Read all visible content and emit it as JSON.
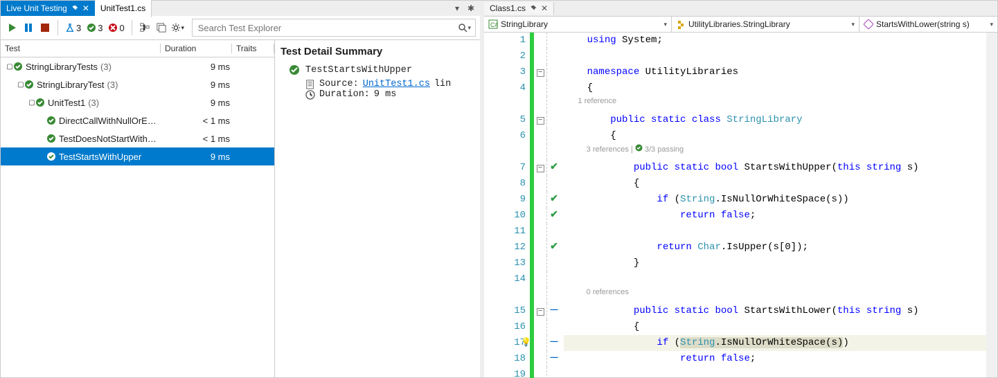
{
  "left": {
    "tabs": {
      "active": "Live Unit Testing",
      "inactive": "UnitTest1.cs"
    },
    "toolbar": {
      "flask_count": "3",
      "pass_count": "3",
      "fail_count": "0",
      "search_placeholder": "Search Test Explorer"
    },
    "columns": {
      "c1": "Test",
      "c2": "Duration",
      "c3": "Traits"
    },
    "tree": [
      {
        "indent": 0,
        "chev": "▢",
        "name": "StringLibraryTests",
        "count": "(3)",
        "dur": "9 ms"
      },
      {
        "indent": 1,
        "chev": "▢",
        "name": "StringLibraryTest",
        "count": "(3)",
        "dur": "9 ms"
      },
      {
        "indent": 2,
        "chev": "▢",
        "name": "UnitTest1",
        "count": "(3)",
        "dur": "9 ms"
      },
      {
        "indent": 3,
        "chev": "",
        "name": "DirectCallWithNullOrE…",
        "count": "",
        "dur": "< 1 ms"
      },
      {
        "indent": 3,
        "chev": "",
        "name": "TestDoesNotStartWith…",
        "count": "",
        "dur": "< 1 ms"
      },
      {
        "indent": 3,
        "chev": "",
        "name": "TestStartsWithUpper",
        "count": "",
        "dur": "9 ms",
        "selected": true
      }
    ],
    "detail": {
      "title": "Test Detail Summary",
      "test_name": "TestStartsWithUpper",
      "source_label": "Source:",
      "source_link": "UnitTest1.cs",
      "source_suffix": "lin",
      "duration_label": "Duration:",
      "duration_value": "9 ms"
    }
  },
  "right": {
    "tab": "Class1.cs",
    "nav": {
      "a": "StringLibrary",
      "b": "UtilityLibraries.StringLibrary",
      "c": "StartsWithLower(string s)"
    },
    "codelens": {
      "class": "1 reference",
      "upper": "3 references",
      "upper_pass": "3/3 passing",
      "lower": "0 references"
    },
    "selected_text": "String.IsNullOrWhiteSpace(s)"
  },
  "chart_data": null
}
